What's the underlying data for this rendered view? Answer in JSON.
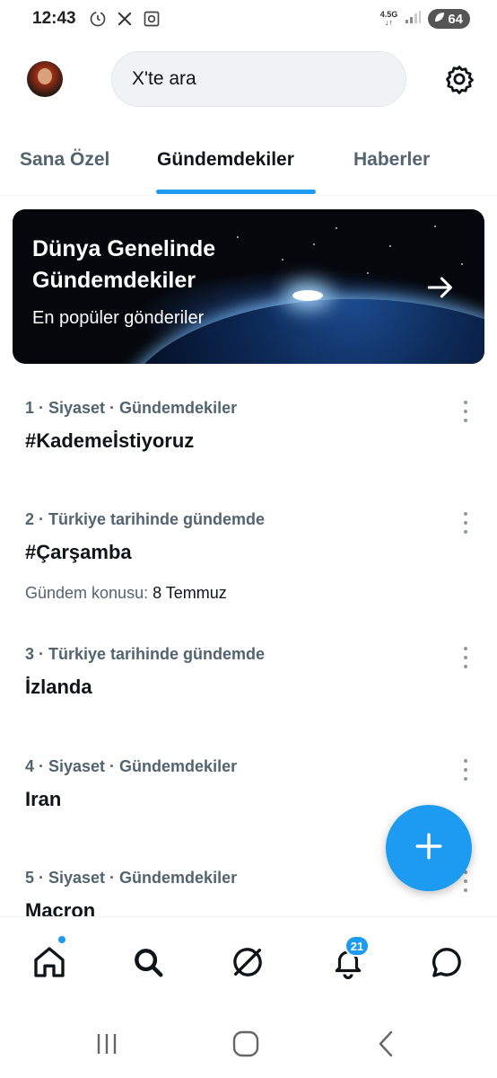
{
  "status_bar": {
    "time": "12:43",
    "network_type": "4.5G",
    "battery": "64",
    "left_icons": [
      "clock-outline-icon",
      "x-logo-icon",
      "screenshot-icon"
    ]
  },
  "header": {
    "search_placeholder": "X'te ara",
    "settings_icon": "gear-icon"
  },
  "tabs": [
    {
      "label": "Sana Özel",
      "active": false
    },
    {
      "label": "Gündemdekiler",
      "active": true
    },
    {
      "label": "Haberler",
      "active": false
    }
  ],
  "banner": {
    "title": "Dünya Genelinde Gündemdekiler",
    "subtitle": "En popüler gönderiler"
  },
  "trends": [
    {
      "meta": "1 · Siyaset · Gündemdekiler",
      "name": "#Kademeİstiyoruz",
      "extra_label": "",
      "extra_value": ""
    },
    {
      "meta": "2 · Türkiye tarihinde gündemde",
      "name": "#Çarşamba",
      "extra_label": "Gündem konusu: ",
      "extra_value": "8 Temmuz"
    },
    {
      "meta": "3 · Türkiye tarihinde gündemde",
      "name": "İzlanda",
      "extra_label": "",
      "extra_value": ""
    },
    {
      "meta": "4 · Siyaset · Gündemdekiler",
      "name": "Iran",
      "extra_label": "",
      "extra_value": ""
    },
    {
      "meta": "5 · Siyaset · Gündemdekiler",
      "name": "Macron",
      "extra_label": "",
      "extra_value": ""
    }
  ],
  "bottom_nav": {
    "items": [
      "home-icon",
      "search-icon",
      "grok-icon",
      "notifications-icon",
      "messages-icon"
    ],
    "notification_count": "21"
  },
  "colors": {
    "accent": "#1d9bf0",
    "text_primary": "#0f1419",
    "text_secondary": "#536471"
  }
}
